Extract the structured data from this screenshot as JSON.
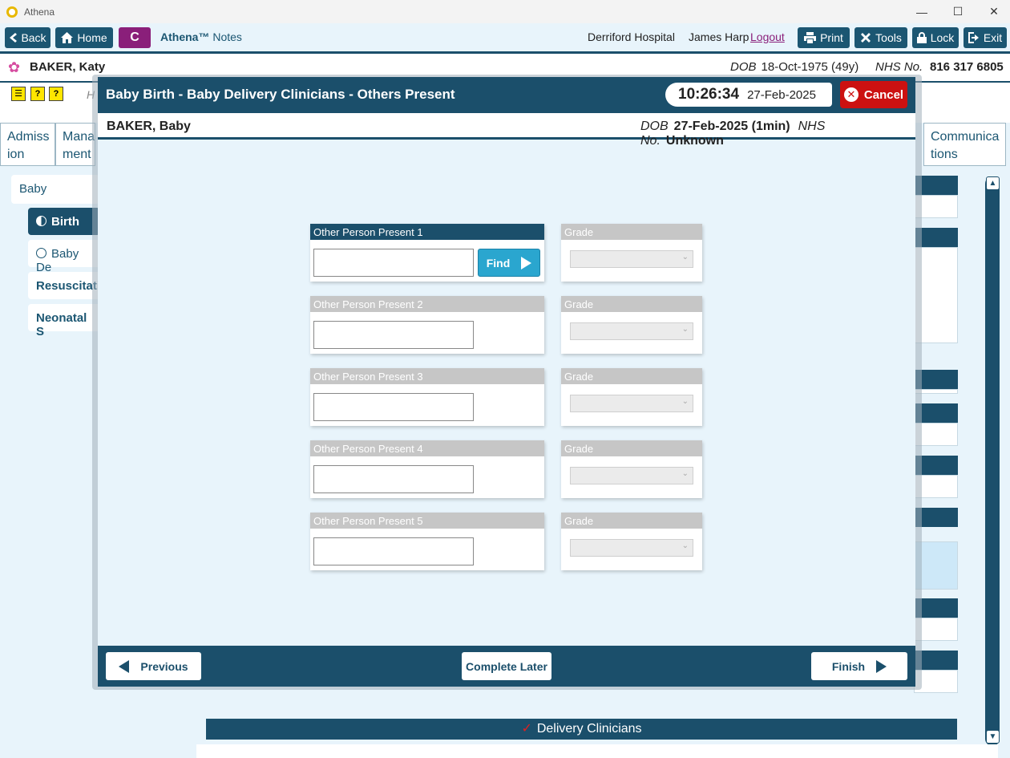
{
  "window": {
    "title": "Athena",
    "minimize": "—",
    "maximize": "☐",
    "close": "✕"
  },
  "toolbar": {
    "back": "Back",
    "home": "Home",
    "badge": "C",
    "brand_name": "Athena™",
    "brand_suffix": "Notes",
    "hospital": "Derriford Hospital",
    "user": "James Harp",
    "logout": "Logout",
    "print": "Print",
    "tools": "Tools",
    "lock": "Lock",
    "exit": "Exit"
  },
  "patient": {
    "name": "BAKER, Katy",
    "dob_label": "DOB",
    "dob": "18-Oct-1975 (49y)",
    "nhs_label": "NHS No.",
    "nhs": "816 317 6805"
  },
  "background": {
    "h_text": "H",
    "tabs": [
      {
        "label_l1": "Admiss",
        "label_l2": "ion"
      },
      {
        "label_l1": "Mana",
        "label_l2": "ment"
      },
      {
        "label_l1": "Communica",
        "label_l2": "tions"
      }
    ],
    "nav": {
      "group": "Baby",
      "items": [
        "Birth",
        "Baby De",
        "Resuscitati",
        "Neonatal S"
      ]
    },
    "bottom_section": "Delivery Clinicians"
  },
  "modal": {
    "title": "Baby Birth - Baby Delivery Clinicians - Others Present",
    "time": "10:26:34",
    "date": "27-Feb-2025",
    "cancel": "Cancel",
    "baby": {
      "name": "BAKER, Baby",
      "dob_label": "DOB",
      "dob": "27-Feb-2025 (1min)",
      "nhs_label": "NHS No.",
      "nhs": "Unknown"
    },
    "persons": [
      {
        "label": "Other Person Present 1",
        "value": "",
        "grade_label": "Grade",
        "grade": ""
      },
      {
        "label": "Other Person Present 2",
        "value": "",
        "grade_label": "Grade",
        "grade": ""
      },
      {
        "label": "Other Person Present 3",
        "value": "",
        "grade_label": "Grade",
        "grade": ""
      },
      {
        "label": "Other Person Present 4",
        "value": "",
        "grade_label": "Grade",
        "grade": ""
      },
      {
        "label": "Other Person Present 5",
        "value": "",
        "grade_label": "Grade",
        "grade": ""
      }
    ],
    "find": "Find",
    "footer": {
      "previous": "Previous",
      "complete_later": "Complete Later",
      "finish": "Finish"
    }
  },
  "colors": {
    "primary": "#1b4f6b",
    "accent": "#2aa6cf",
    "danger": "#cc1111",
    "badge": "#8a1f7a"
  }
}
